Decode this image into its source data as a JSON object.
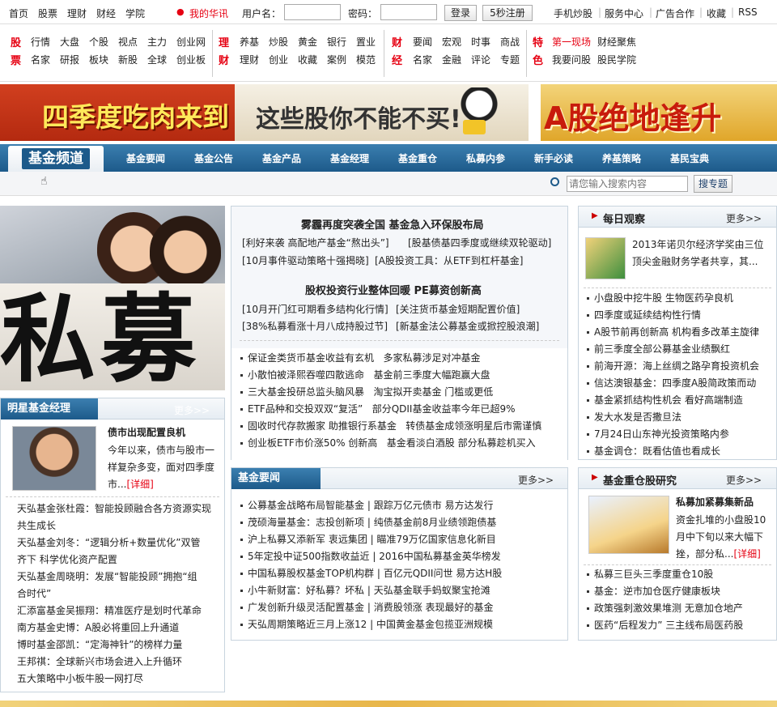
{
  "topbar": {
    "links": [
      "首页",
      "股票",
      "理财",
      "财经",
      "学院"
    ],
    "my": "我的华讯",
    "user_label": "用户名：",
    "pass_label": "密码：",
    "login": "登录",
    "reg": "5秒注册",
    "right": [
      "手机炒股",
      "服务中心",
      "广告合作",
      "收藏",
      "RSS"
    ]
  },
  "nav": {
    "g1": {
      "a": "股",
      "b": "票",
      "r1": [
        "行情",
        "大盘",
        "个股",
        "视点",
        "主力",
        "创业网"
      ],
      "r2": [
        "名家",
        "研报",
        "板块",
        "新股",
        "全球",
        "创业板"
      ]
    },
    "g2": {
      "a": "理",
      "b": "财",
      "r1": [
        "养基",
        "炒股",
        "黄金",
        "银行",
        "置业"
      ],
      "r2": [
        "理财",
        "创业",
        "收藏",
        "案例",
        "模范"
      ]
    },
    "g3": {
      "a": "财",
      "b": "经",
      "r1": [
        "要闻",
        "宏观",
        "时事",
        "商战"
      ],
      "r2": [
        "名家",
        "金融",
        "评论",
        "专题"
      ]
    },
    "g4": {
      "a": "特",
      "b": "色",
      "r1": [
        "第一现场",
        "财经聚焦"
      ],
      "r2": [
        "我要问股",
        "股民学院"
      ]
    }
  },
  "banner1": {
    "t1": "四季度吃肉来到",
    "t2": "这些股你不能不买!"
  },
  "banner2": {
    "t": "A股绝地逢升"
  },
  "channel": {
    "logo": "基金频道",
    "tabs": [
      "基金要闻",
      "基金公告",
      "基金产品",
      "基金经理",
      "基金重仓",
      "私募内参",
      "新手必读",
      "养基策略",
      "基民宝典"
    ],
    "search_placeholder": "请您输入搜索内容",
    "search_btn": "搜专题"
  },
  "hero": {
    "text": "私募"
  },
  "center_top": {
    "h1": "雾霾再度突袭全国 基金急入环保股布局",
    "l1a": "[利好来袭 高配地产基金“熬出头”]",
    "l1b": "[股基债基四季度或继续双轮驱动]",
    "l2a": "[10月事件驱动策略十强揭晓]",
    "l2b": "[A股投资工具：从ETF到杠杆基金]",
    "h2": "股权投资行业整体回暖 PE募资创新高",
    "l3a": "[10月开门红可期看多结构化行情]",
    "l3b": "[关注货币基金短期配置价值]",
    "l4a": "[38%私募看涨十月八成持股过节]",
    "l4b": "[新基金法公募基金或掀控股浪潮]",
    "items": [
      [
        "保证金类货币基金收益有玄机",
        "多家私募涉足对冲基金"
      ],
      [
        "小散怕被泽熙吞噬四散逃命",
        "基金前三季度大幅跑赢大盘"
      ],
      [
        "三大基金投研总监头脑风暴",
        "淘宝拟开卖基金 门槛或更低"
      ],
      [
        "ETF品种和交投双双“复活”",
        "部分QDII基金收益率今年已超9%"
      ],
      [
        "固收时代存款搬家 助推银行系基金",
        "转债基金成领涨明星后市需谨慎"
      ],
      [
        "创业板ETF市价涨50% 创新高",
        "基金看淡白酒股 部分私募趁机买入"
      ]
    ]
  },
  "center_bottom": {
    "title": "基金要闻",
    "more": "更多>>",
    "items": [
      [
        "公募基金战略布局智能基金",
        "跟踪万亿元债市 易方达发行"
      ],
      [
        "茂硕海量基金：志投创新项",
        "纯债基金前8月业绩领跑债基"
      ],
      [
        "沪上私募又添新军 衷远集团",
        "瞄准79万亿国家信息化新目"
      ],
      [
        "5年定投中证500指数收益近",
        "2016中国私募基金英华榜发"
      ],
      [
        "中国私募股权基金TOP机构群",
        "百亿元QDII问世 易方达H股"
      ],
      [
        "小牛新财富：好私募？坏私",
        "天弘基金联手蚂蚁聚宝抢滩"
      ],
      [
        "广发创新升级灵活配置基金",
        "消费股领涨 表现最好的基金"
      ],
      [
        "天弘周期策略近三月上涨12",
        "中国黄金基金包揽亚洲规模"
      ]
    ]
  },
  "left": {
    "title": "明星基金经理",
    "more": "更多>>",
    "feat_title": "债市出现配置良机",
    "feat_lines": [
      "今年以来，债市与股市一",
      "样复杂多变，面对四季度",
      "市..."
    ],
    "detail": "[详细]",
    "items": [
      "天弘基金张杜霞：智能投顾融合各方资源实现",
      "共生成长",
      "天弘基金刘冬：“逻辑分析+数量优化”双管",
      "齐下 科学优化资产配置",
      "天弘基金周晓明：发展“智能投顾”拥抱“组",
      "合时代”",
      "汇添富基金吴振翔：精准医疗是划时代革命",
      "南方基金史博：A股必将重回上升通道",
      "博时基金邵凯：“定海神针”的榜样力量",
      "王邦祺：全球新兴市场会进入上升循环",
      "五大策略中小板牛股一网打尽"
    ]
  },
  "right1": {
    "title": "每日观察",
    "more": "更多>>",
    "feat_lines": [
      "2013年诺贝尔经济学奖由三位",
      "顶尖金融财务学者共享，其..."
    ],
    "items": [
      "小盘股中挖牛股 生物医药孕良机",
      "四季度或延续结构性行情",
      "A股节前再创新高 机构看多改革主旋律",
      "前三季度全部公募基金业绩飘红",
      "前海开源：海上丝绸之路孕育投资机会",
      "信达澳银基金：四季度A股简政策而动",
      "基金紧抓结构性机会 看好高端制造",
      "发大水发是否撒旦法",
      "7月24日山东神光投资策略内参",
      "基金调仓：既看估值也看成长"
    ]
  },
  "right2": {
    "title": "基金重仓股研究",
    "more": "更多>>",
    "feat_title": "私募加紧募集新品",
    "feat_lines": [
      "资金扎堆的小盘股10",
      "月中下旬以来大幅下",
      "挫，部分私..."
    ],
    "detail": "[详细]",
    "items": [
      "私募三巨头三季度重仓10股",
      "基金：逆市加仓医疗健康板块",
      "政策强刺激效果堆测 无意加仓地产",
      "医药“后程发力” 三主线布局医药股"
    ]
  }
}
